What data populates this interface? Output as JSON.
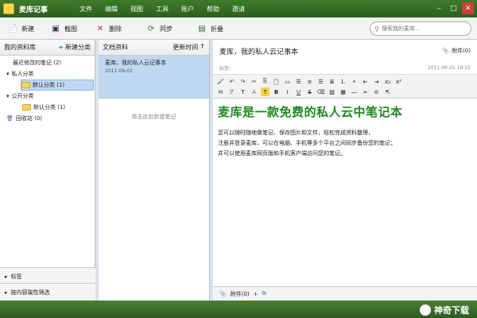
{
  "app": {
    "title": "麦库记事"
  },
  "menu": [
    "文件",
    "编辑",
    "视图",
    "工具",
    "账户",
    "帮助",
    "邀请"
  ],
  "toolbar": {
    "new": "新建",
    "screenshot": "截图",
    "delete": "删除",
    "sync": "同步",
    "fold": "折叠",
    "search_placeholder": "搜索我的麦库..."
  },
  "left": {
    "header": "我的资料库",
    "new_category": "新建分类",
    "recent": "最近修改的笔记 (2)",
    "private": "私人分类",
    "private_default": "默认分类 (1)",
    "public": "公开分类",
    "public_default": "默认分类 (1)",
    "trash": "回收站 (0)",
    "tags": "标签",
    "filter": "按内容属性筛选"
  },
  "middle": {
    "header": "文档资料",
    "sort": "更新时间",
    "note_title": "麦库，我的私人云记事本",
    "note_date": "2011-09-01",
    "hint": "单击此处新建笔记"
  },
  "editor": {
    "title": "麦库，我的私人云记事本",
    "attachment": "附件(0)",
    "tag_label": "标签：",
    "datetime": "2011-09-01 18:22",
    "heading": "麦库是一款免费的私人云中笔记本",
    "paragraphs": [
      "您可以随时随地做笔记、保存图片和文件，轻松完成资料整理，",
      "注册并登录麦库，可以在电脑、手机等多个平台之间同步备份您的笔记；",
      "并可以使用麦库网页版和手机客户端访问您的笔记。"
    ],
    "footer_attachment": "附件(0)"
  },
  "brand": {
    "text": "神奇下载"
  }
}
